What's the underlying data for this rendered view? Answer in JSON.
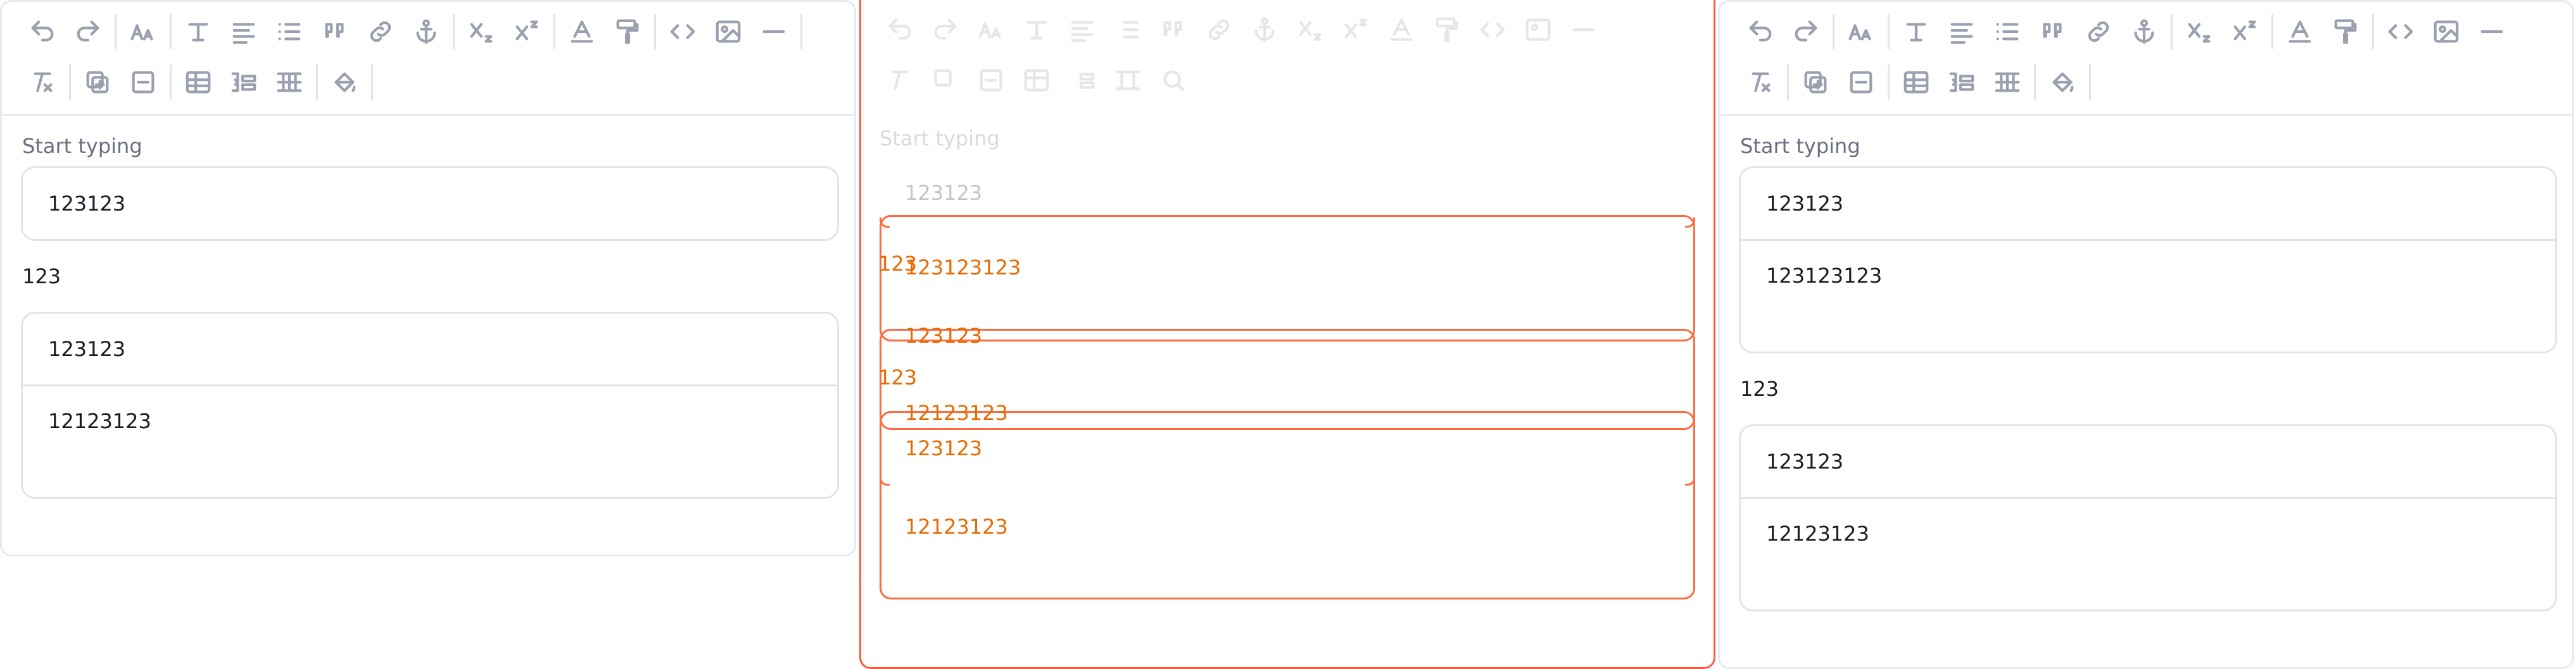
{
  "editor": {
    "placeholder": "Start typing",
    "left": {
      "block1": [
        "123123"
      ],
      "para": "123",
      "block2": [
        "123123",
        "12123123"
      ]
    },
    "middle": {
      "row1": "123123123",
      "row2": "123123",
      "row3": "123",
      "row4": "12123123",
      "row5": "123123",
      "row6": "12123123",
      "para": "123"
    },
    "right": {
      "block1": [
        "123123",
        "123123123"
      ],
      "para": "123",
      "block2": [
        "123123",
        "12123123"
      ]
    }
  },
  "toolbar_icons": {
    "row1": [
      "undo-icon",
      "redo-icon",
      "font-size-icon",
      "text-style-icon",
      "align-icon",
      "bullet-list-icon",
      "blockquote-icon",
      "link-icon",
      "anchor-icon",
      "subscript-icon",
      "superscript-icon",
      "text-color-icon",
      "format-painter-icon",
      "code-icon",
      "image-icon",
      "horizontal-rule-icon"
    ],
    "row2": [
      "clear-format-icon",
      "add-block-icon",
      "remove-block-icon",
      "table-icon",
      "indent-icon",
      "grid-icon",
      "fill-color-icon"
    ]
  },
  "colors": {
    "border": "#e8e9ee",
    "icon": "#9aa0b0",
    "highlight": "#ff5a3c",
    "highlight_text": "#e86a00"
  }
}
